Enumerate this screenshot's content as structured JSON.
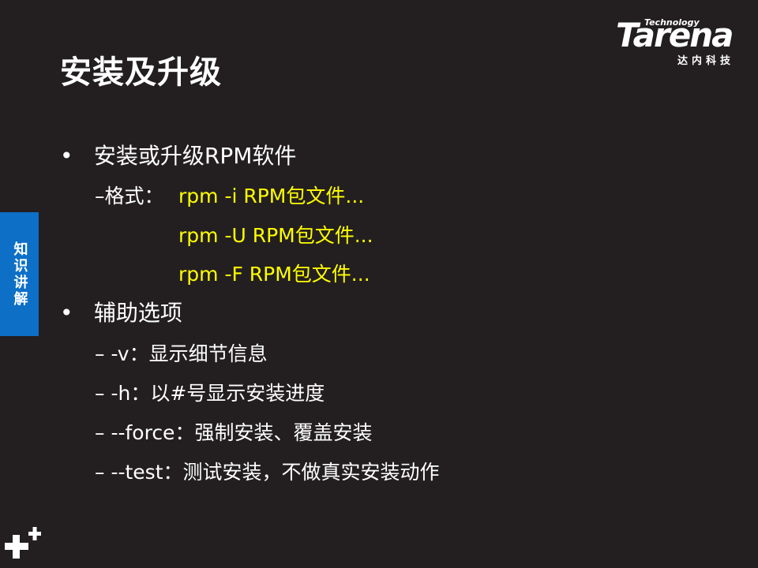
{
  "slide": {
    "title": "安装及升级",
    "side_tab": "知识讲解"
  },
  "logo": {
    "tech": "Technology",
    "main": "Tarena",
    "sub": "达内科技"
  },
  "bullets": {
    "b1": {
      "marker": "•",
      "text": "安装或升级RPM软件",
      "format_prefix": "–格式：",
      "format_lines": [
        "rpm -i RPM包文件...",
        "rpm -U RPM包文件...",
        "rpm -F RPM包文件..."
      ]
    },
    "b2": {
      "marker": "•",
      "text": "辅助选项",
      "options": [
        "– -v：显示细节信息",
        "– -h：以#号显示安装进度",
        "– --force：强制安装、覆盖安装",
        "– --test：测试安装，不做真实安装动作"
      ]
    }
  },
  "colors": {
    "background": "#231f20",
    "accent_blue": "#0d6fc6",
    "highlight_yellow": "#ffff00",
    "text": "#ffffff"
  }
}
